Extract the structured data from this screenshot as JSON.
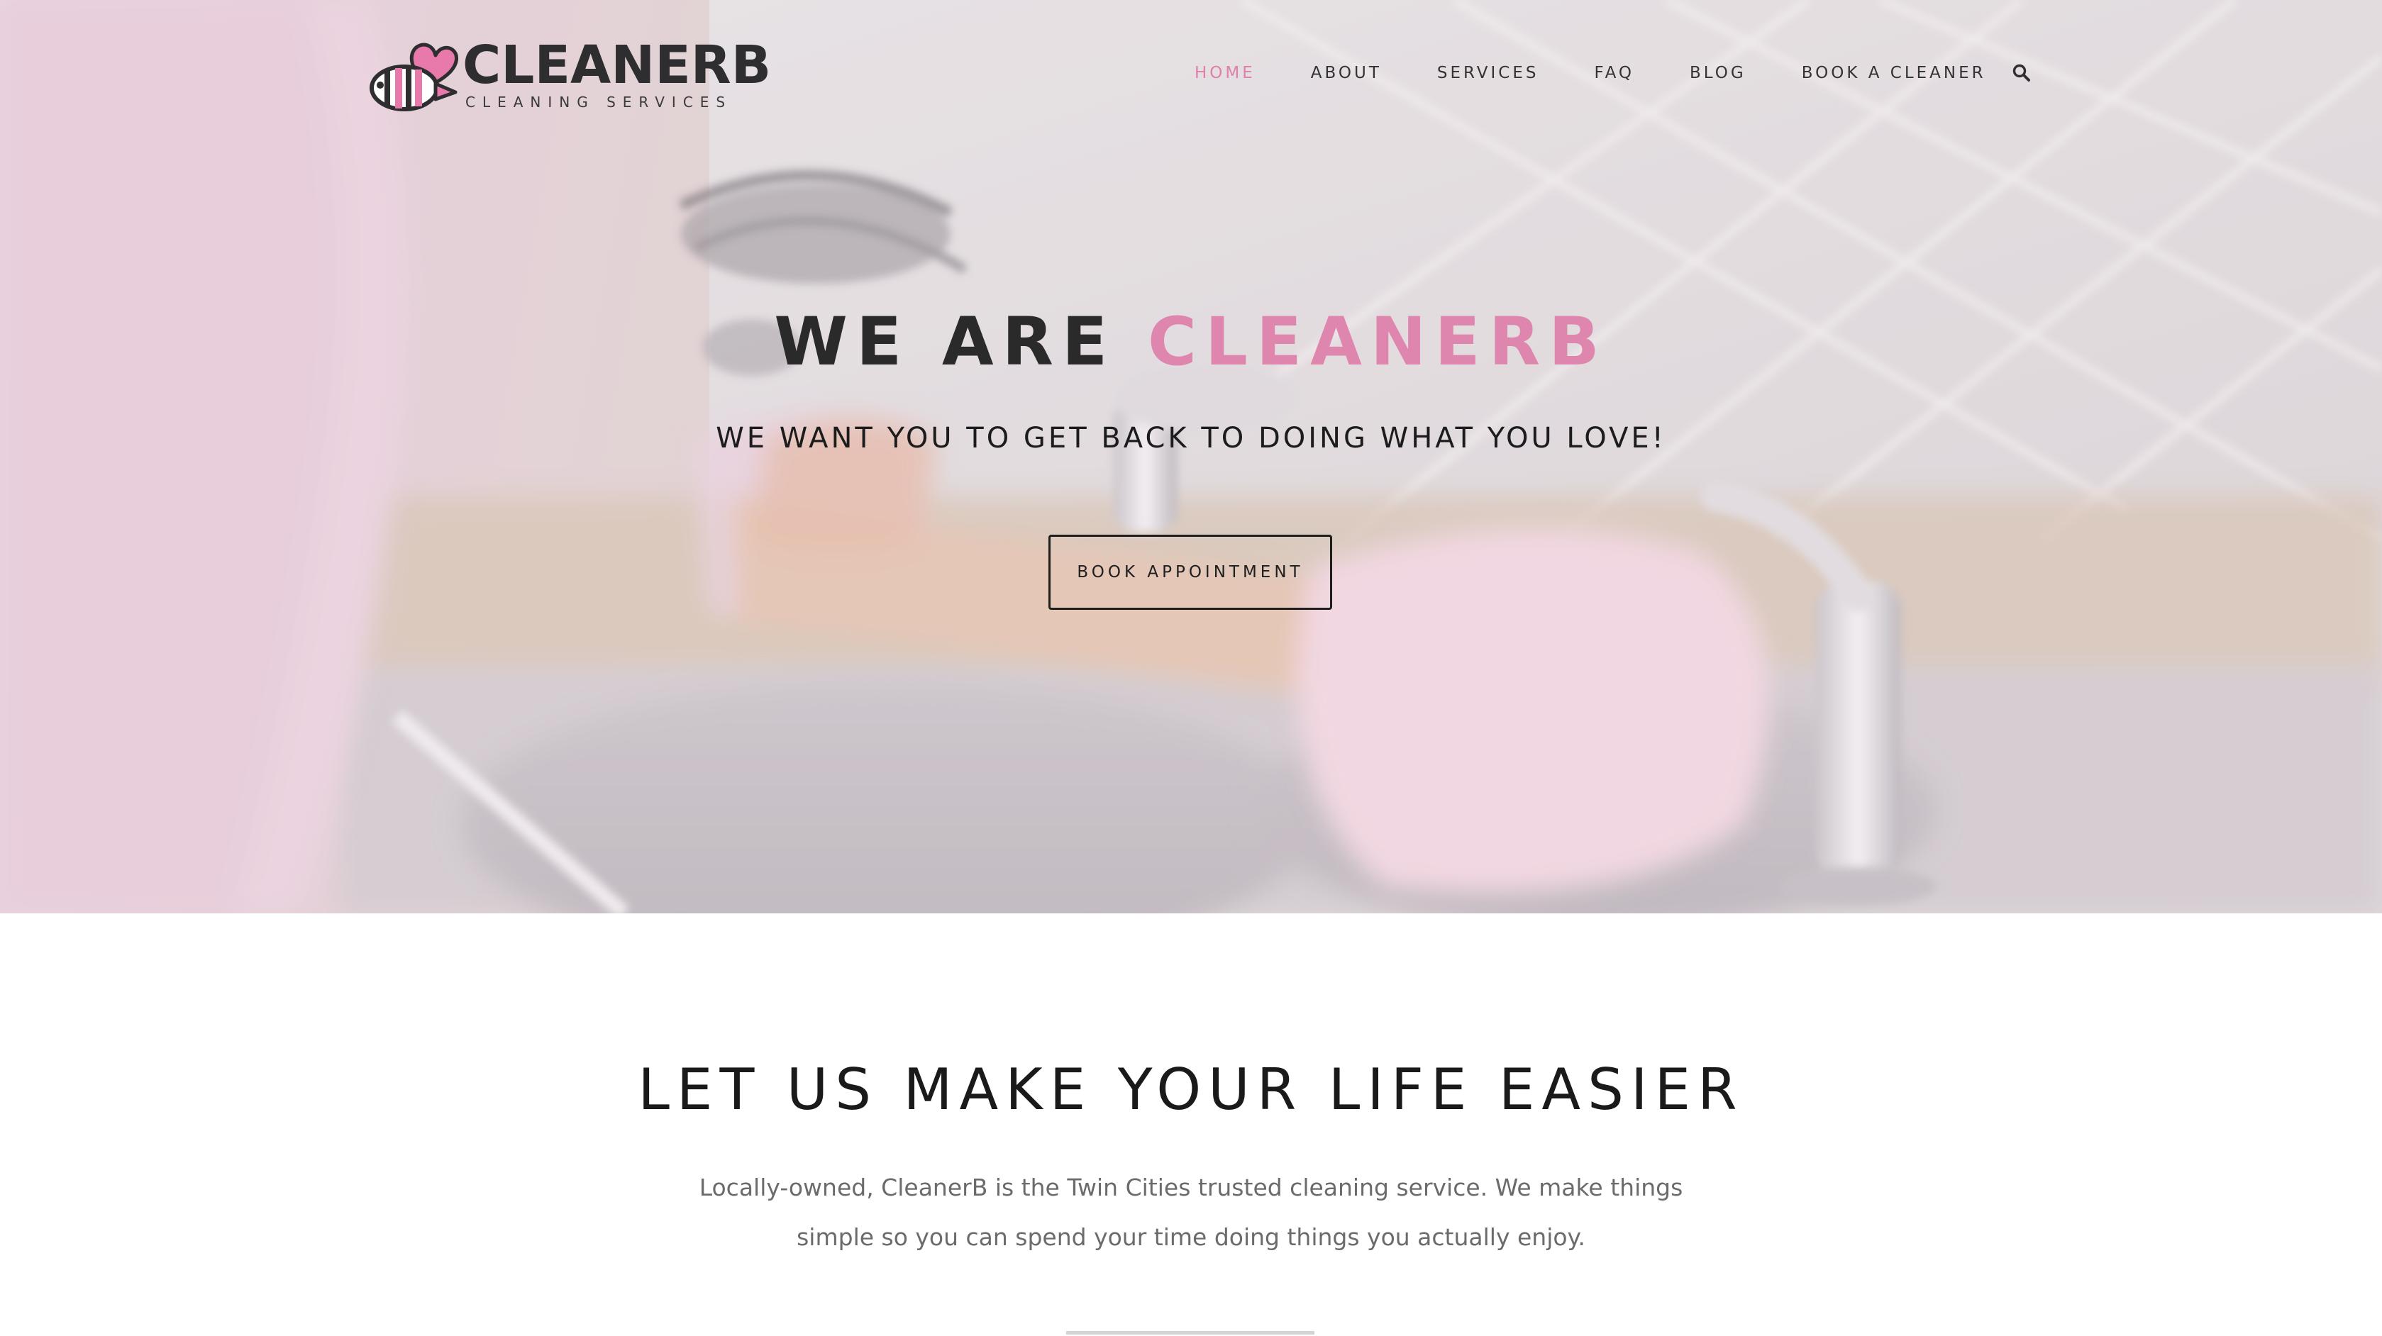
{
  "brand": {
    "name": "CLEANERB",
    "tagline": "CLEANING SERVICES"
  },
  "nav": {
    "items": [
      {
        "label": "HOME",
        "active": true
      },
      {
        "label": "ABOUT",
        "active": false
      },
      {
        "label": "SERVICES",
        "active": false
      },
      {
        "label": "FAQ",
        "active": false
      },
      {
        "label": "BLOG",
        "active": false
      },
      {
        "label": "BOOK A CLEANER",
        "active": false
      }
    ],
    "search_icon": "search-icon"
  },
  "hero": {
    "title_lead": "WE ARE",
    "title_accent": "CLEANERB",
    "subtitle": "WE WANT YOU TO GET BACK TO DOING WHAT YOU LOVE!",
    "button_label": "BOOK APPOINTMENT"
  },
  "intro": {
    "heading": "LET US MAKE YOUR LIFE EASIER",
    "body": "Locally-owned, CleanerB is the Twin Cities trusted cleaning service. We make things simple so you can spend your time doing things you actually enjoy."
  },
  "colors": {
    "accent": "#df86ae",
    "nav_active": "#e07fa9",
    "text_dark": "#2a2a2a",
    "body_text": "#6b6b6b"
  }
}
